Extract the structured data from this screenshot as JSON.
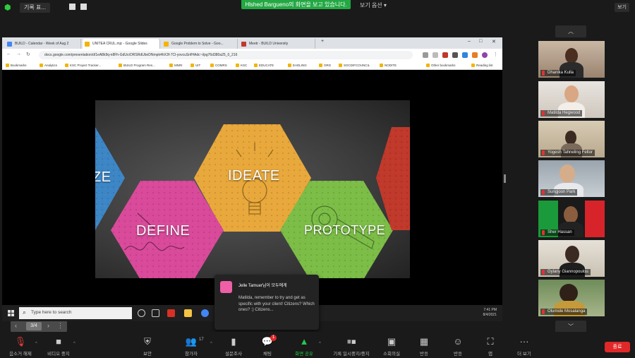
{
  "topbar": {
    "meeting_info": "기록 표...",
    "share_banner": "Hlshed Bargueno의 화면을 보고 있습니다.",
    "view_option": "보기 옵션 ▾",
    "view_button": "보기"
  },
  "browser": {
    "tabs": [
      {
        "label": "BUILD - Calendar - Week of Aug 2",
        "color": "#4285f4",
        "active": false
      },
      {
        "label": "UNITEA CRUL.mjc - Google Slides",
        "color": "#f4b400",
        "active": true
      },
      {
        "label": "Google Problem to Solve - Goo...",
        "color": "#f4b400",
        "active": false
      },
      {
        "label": "Meetr - BUILD University",
        "color": "#c0392b",
        "active": false
      }
    ],
    "url": "docs.google.com/presentation/d/1eA8k9q-n8Fh-GdUcrDRSRdUbnDNmpk4hX3f-7Cl-yovcuSnfHAdc~i/pg76d380a25_0_216",
    "bookmarks": [
      "Bookmarks",
      "Analytics",
      "KSC Project Tracker...",
      "BUILD Program Res...",
      "MNRI",
      "UIT",
      "COMRS",
      "KSC",
      "EDUCATE",
      "EADLING",
      "ORG",
      "SOCDIFCOUNCIL",
      "NODITE",
      "Other bookmarks",
      "Reading list"
    ]
  },
  "slide": {
    "labels": {
      "left": "ZE",
      "ideate": "IDEATE",
      "define": "DEFINE",
      "prototype": "PROTOTYPE"
    },
    "colors": {
      "empathize": "#3d86c6",
      "ideate": "#e8a83b",
      "define": "#d94a9a",
      "prototype": "#7cbd47",
      "test": "#c0392b"
    },
    "page_indicator": "3/4"
  },
  "taskbar": {
    "search_placeholder": "Type here to search",
    "clock_time": "7:41 PM",
    "clock_date": "8/4/2021"
  },
  "chat_popup": {
    "sender": "Jelle Tamuer님이 모두에게",
    "message": "Matilda, remember to try and get as specific with your client! Citizens? Which ones? :) Citizens..."
  },
  "participants": [
    {
      "name": "Dhanika Kulla"
    },
    {
      "name": "Matilda Hegwood"
    },
    {
      "name": "Yogesh Tahneling Feltor"
    },
    {
      "name": "Sungjoon Park"
    },
    {
      "name": "Sher Hassan"
    },
    {
      "name": "Gylany Giannopoulou"
    },
    {
      "name": "Olumide Mosalanga"
    }
  ],
  "toolbar": {
    "mute": "음소거 해제",
    "video": "비디오 중지",
    "security": "보안",
    "participants": "참가자",
    "participants_count": "17",
    "polls": "설문조사",
    "chat": "채팅",
    "chat_badge": "1",
    "share": "화면 공유",
    "record": "기록 일시중지/중지",
    "breakout": "소회의실",
    "reactions": "반응",
    "apps": "앱",
    "more": "더 보기",
    "end": "종료"
  }
}
